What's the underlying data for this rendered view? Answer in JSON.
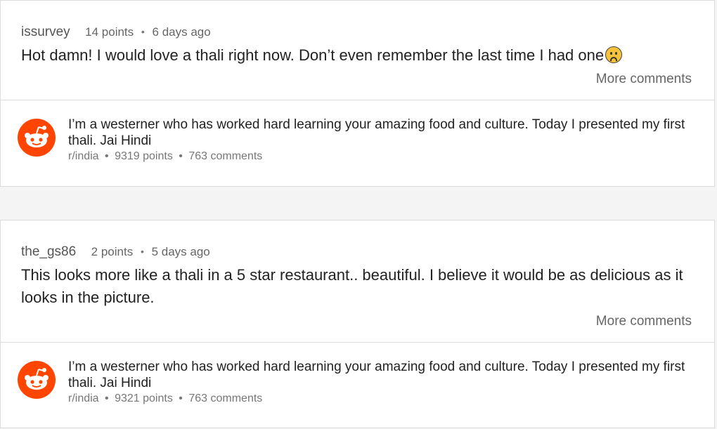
{
  "threads": [
    {
      "comment": {
        "author": "issurvey",
        "points": "14 points",
        "age": "6 days ago",
        "text": "Hot damn! I would love a thali right now. Don’t even remember the last time I had one",
        "emoji": "frowning-face",
        "more_label": "More comments"
      },
      "post": {
        "title": "I’m a westerner who has worked hard learning your amazing food and culture. Today I presented my first thali. Jai Hindi",
        "subreddit": "r/india",
        "points": "9319 points",
        "comments": "763 comments",
        "icon": "reddit-alien-icon"
      }
    },
    {
      "comment": {
        "author": "the_gs86",
        "points": "2 points",
        "age": "5 days ago",
        "text": "This looks more like a thali in a 5 star restaurant.. beautiful. I believe it would be as delicious as it looks in the picture.",
        "more_label": "More comments"
      },
      "post": {
        "title": "I’m a westerner who has worked hard learning your amazing food and culture. Today I presented my first thali. Jai Hindi",
        "subreddit": "r/india",
        "points": "9321 points",
        "comments": "763 comments",
        "icon": "reddit-alien-icon"
      }
    }
  ],
  "colors": {
    "brand": "#ff4500",
    "meta_text": "#777777",
    "border": "#dcdcdc"
  },
  "separator": "•"
}
